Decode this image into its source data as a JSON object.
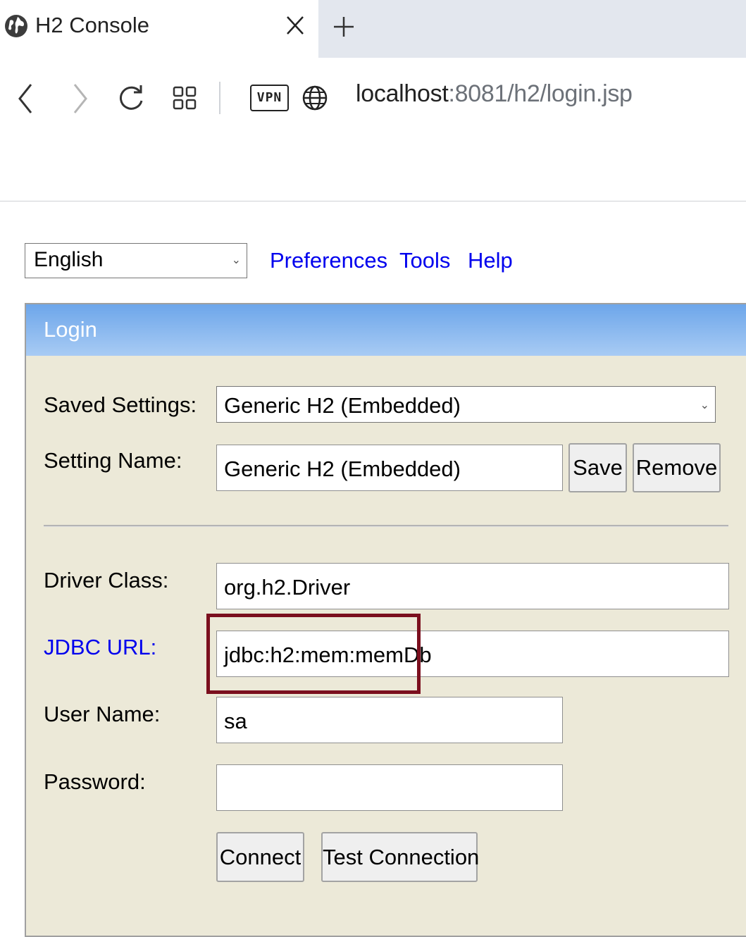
{
  "browser": {
    "tab_title": "H2 Console",
    "url_host": "localhost",
    "url_rest": ":8081/h2/login.jsp",
    "vpn_label": "VPN"
  },
  "toolbar": {
    "language": "English",
    "links": [
      "Preferences",
      "Tools",
      "Help"
    ]
  },
  "login": {
    "title": "Login",
    "saved_settings_label": "Saved Settings:",
    "saved_settings_value": "Generic H2 (Embedded)",
    "setting_name_label": "Setting Name:",
    "setting_name_value": "Generic H2 (Embedded)",
    "save_button": "Save",
    "remove_button": "Remove",
    "driver_class_label": "Driver Class:",
    "driver_class_value": "org.h2.Driver",
    "jdbc_url_label": "JDBC URL:",
    "jdbc_url_value": "jdbc:h2:mem:memDb",
    "user_name_label": "User Name:",
    "user_name_value": "sa",
    "password_label": "Password:",
    "password_value": "",
    "connect_button": "Connect",
    "test_connection_button": "Test Connection"
  },
  "colors": {
    "link": "#0000ee",
    "panel_background": "#ece9d8",
    "header_gradient_top": "#6da6ea",
    "highlight_border": "#7b0f1e"
  }
}
